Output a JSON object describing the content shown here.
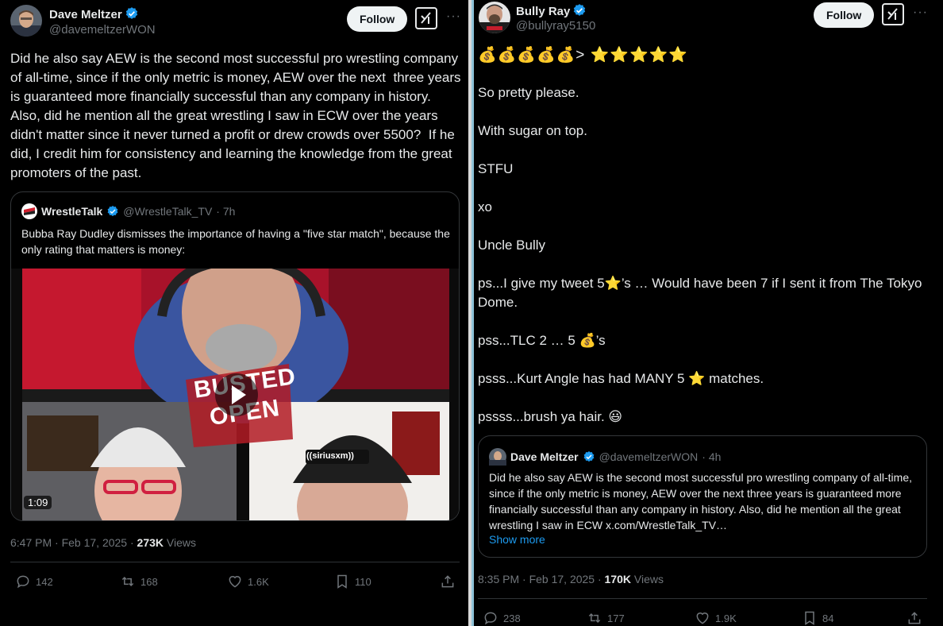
{
  "left_tweet": {
    "author_name": "Dave Meltzer",
    "author_handle": "@davemeltzerWON",
    "follow_label": "Follow",
    "body": "Did he also say AEW is the second most successful pro wrestling company of all-time, since if the only metric is money, AEW over the next  three years is guaranteed more financially successful than any company in history.  Also, did he mention all the great wrestling I saw in ECW over the years didn't matter since it never turned a profit or drew crowds over 5500?  If he did, I credit him for consistency and learning the knowledge from the great promoters of the past.",
    "quote": {
      "author_name": "WrestleTalk",
      "author_handle": "@WrestleTalk_TV",
      "time": "· 7h",
      "text": "Bubba Ray Dudley dismisses the importance of having a \"five star match\", because the only rating that matters is money:",
      "video_duration": "1:09",
      "video_logo_top": "BUSTED",
      "video_logo_bottom": "OPEN",
      "beanie_text": "((siriusxm))"
    },
    "timestamp": "6:47 PM · Feb 17, 2025 · ",
    "views_count": "273K",
    "views_label": " Views",
    "actions": {
      "replies": "142",
      "reposts": "168",
      "likes": "1.6K",
      "bookmarks": "110"
    }
  },
  "right_tweet": {
    "author_name": "Bully Ray",
    "author_handle": "@bullyray5150",
    "follow_label": "Follow",
    "emoji_line": "💰💰💰💰💰> ⭐⭐⭐⭐⭐",
    "lines": [
      "So pretty please.",
      "With sugar on top.",
      "STFU",
      "xo",
      "Uncle Bully",
      "ps...I give my tweet 5⭐’s … Would have been 7 if I sent it from The Tokyo Dome.",
      "pss...TLC 2 … 5 💰’s",
      "psss...Kurt Angle has had MANY 5 ⭐ matches.",
      "pssss...brush ya hair. 😃"
    ],
    "quote": {
      "author_name": "Dave Meltzer",
      "author_handle": "@davemeltzerWON",
      "time": "· 4h",
      "text": "Did he also say AEW is the second most successful pro wrestling company of all-time, since if the only metric is money, AEW over the next  three years is guaranteed more financially successful than any company in history.  Also, did he mention all the great wrestling I saw in ECW x.com/WrestleTalk_TV…",
      "show_more": "Show more"
    },
    "timestamp": "8:35 PM · Feb 17, 2025 · ",
    "views_count": "170K",
    "views_label": " Views",
    "actions": {
      "replies": "238",
      "reposts": "177",
      "likes": "1.9K",
      "bookmarks": "84"
    }
  },
  "colors": {
    "verified": "#1d9bf0",
    "link": "#1d9bf0",
    "muted": "#71767b",
    "divider": "#8fc3d8"
  }
}
